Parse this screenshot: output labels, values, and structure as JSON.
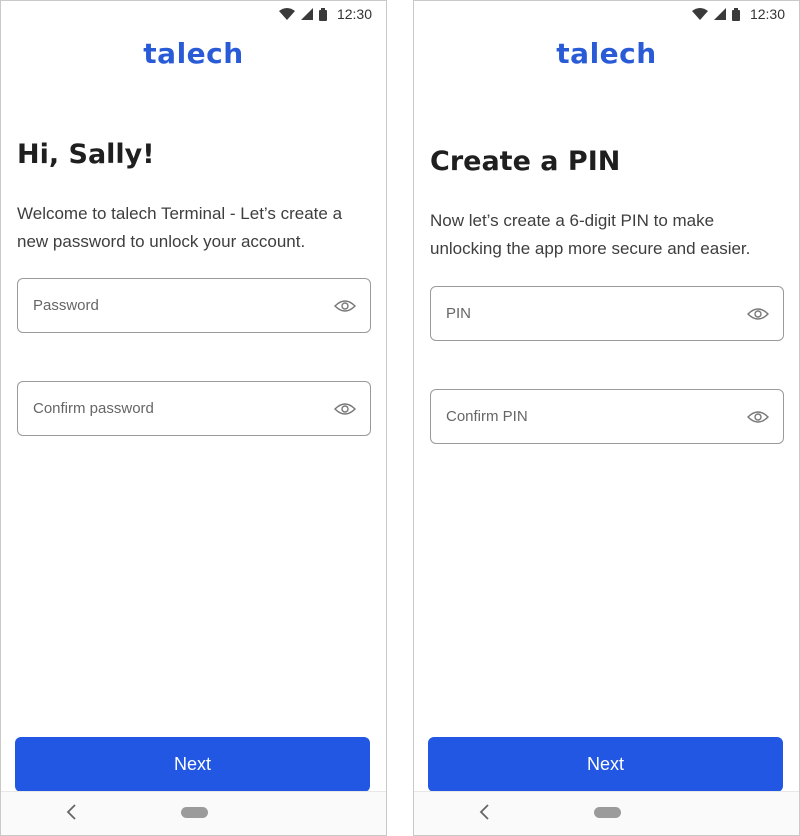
{
  "status_bar": {
    "time": "12:30",
    "icons": [
      "wifi-icon",
      "signal-icon",
      "battery-icon"
    ]
  },
  "brand": {
    "name": "talech",
    "color": "#2a5bd7"
  },
  "accent_color": "#2257e3",
  "screens": [
    {
      "title": "Hi, Sally!",
      "description": "Welcome to talech Terminal - Let’s create a new password to unlock your account.",
      "fields": [
        {
          "placeholder": "Password",
          "icon": "eye-icon"
        },
        {
          "placeholder": "Confirm password",
          "icon": "eye-icon"
        }
      ],
      "button": "Next"
    },
    {
      "title": "Create a PIN",
      "description": "Now let’s create a 6-digit PIN to make unlocking the app more secure and easier.",
      "fields": [
        {
          "placeholder": "PIN",
          "icon": "eye-icon"
        },
        {
          "placeholder": "Confirm PIN",
          "icon": "eye-icon"
        }
      ],
      "button": "Next"
    }
  ],
  "nav_bar": {
    "icons": [
      "back-chevron-icon",
      "home-pill-icon"
    ]
  }
}
